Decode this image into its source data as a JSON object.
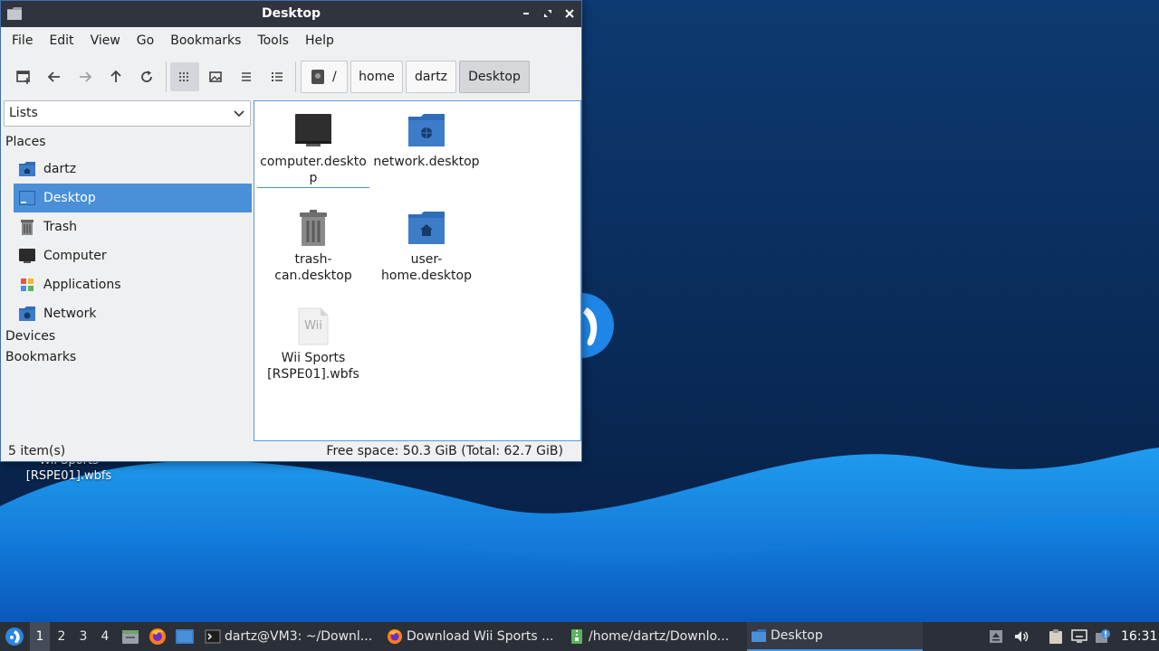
{
  "desktop": {
    "background_label": "Wii Sports\n[RSPE01].wbfs"
  },
  "window": {
    "title": "Desktop",
    "controls": {
      "minimize": "•",
      "maximize": "⤡",
      "close": "✕"
    }
  },
  "menubar": [
    "File",
    "Edit",
    "View",
    "Go",
    "Bookmarks",
    "Tools",
    "Help"
  ],
  "toolbar": {
    "path_root": "/",
    "breadcrumbs": [
      "home",
      "dartz",
      "Desktop"
    ]
  },
  "sidepane": {
    "mode": "Lists",
    "places_header": "Places",
    "places": [
      {
        "label": "dartz",
        "icon": "home-folder-icon"
      },
      {
        "label": "Desktop",
        "icon": "desktop-icon",
        "selected": true
      },
      {
        "label": "Trash",
        "icon": "trash-icon"
      },
      {
        "label": "Computer",
        "icon": "computer-icon"
      },
      {
        "label": "Applications",
        "icon": "applications-icon"
      },
      {
        "label": "Network",
        "icon": "network-folder-icon"
      }
    ],
    "devices_header": "Devices",
    "bookmarks_header": "Bookmarks"
  },
  "files": [
    {
      "label": "computer.desktop",
      "icon": "computer-icon"
    },
    {
      "label": "network.desktop",
      "icon": "network-folder-icon"
    },
    {
      "label": "trash-can.desktop",
      "icon": "trash-icon"
    },
    {
      "label": "user-home.desktop",
      "icon": "home-folder-icon"
    },
    {
      "label": "Wii Sports [RSPE01].wbfs",
      "icon": "wii-file-icon",
      "icon_text": "Wii"
    }
  ],
  "file_labels": {
    "computer": "computer.deskto p",
    "network": "network.desktop",
    "trash": "trash-\ncan.desktop",
    "home": "user-\nhome.desktop",
    "wii": "Wii Sports\n[RSPE01].wbfs",
    "wii_icon_text": "Wii"
  },
  "statusbar": {
    "count": "5 item(s)",
    "free": "Free space: 50.3 GiB (Total: 62.7 GiB)"
  },
  "taskbar": {
    "desktops": [
      "1",
      "2",
      "3",
      "4"
    ],
    "tasks": [
      {
        "label": "dartz@VM3: ~/Downl...",
        "icon": "terminal-icon"
      },
      {
        "label": "Download Wii Sports ...",
        "icon": "firefox-icon"
      },
      {
        "label": "/home/dartz/Downlo...",
        "icon": "archive-icon"
      },
      {
        "label": "Desktop",
        "icon": "folder-icon",
        "active": true
      }
    ],
    "clock": "16:31"
  },
  "colors": {
    "accent": "#4a90d9",
    "titlebar": "#2f343f",
    "taskbar": "#2b2f37",
    "folder_blue": "#3d7cc9"
  }
}
